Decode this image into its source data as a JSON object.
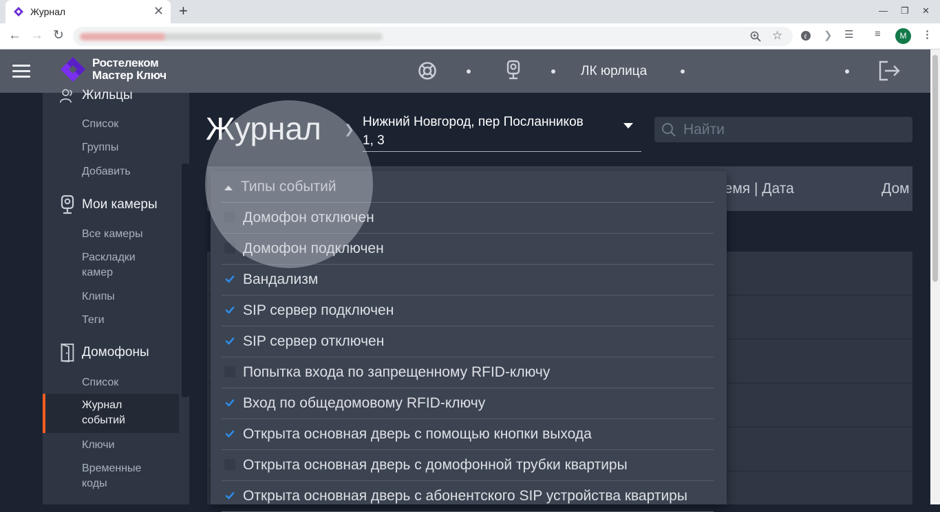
{
  "browser": {
    "tab_title": "Журнал",
    "tab_close": "✕",
    "new_tab": "+",
    "profile_initial": "M"
  },
  "header": {
    "logo_line1": "Ростелеком",
    "logo_line2": "Мастер Ключ",
    "account_link": "ЛК юрлица"
  },
  "sidebar": {
    "residents": {
      "label": "Жильцы",
      "items": [
        "Список",
        "Группы",
        "Добавить"
      ]
    },
    "cameras": {
      "label": "Мои камеры",
      "items": [
        "Все камеры",
        "Раскладки",
        "камер",
        "Клипы",
        "Теги"
      ]
    },
    "intercoms": {
      "label": "Домофоны",
      "items": [
        "Список",
        "Журнал",
        "событий",
        "Ключи",
        "Временные",
        "коды"
      ]
    }
  },
  "main": {
    "title": "Журнал",
    "address_line1": "Нижний Новгород, пер Посланников",
    "address_line2": "1, 3",
    "search_placeholder": "Найти",
    "columns": [
      "ремя | Дата",
      "Дом"
    ]
  },
  "filter": {
    "title": "Типы событий",
    "options": [
      {
        "label": "Домофон отключен",
        "checked": false
      },
      {
        "label": "Домофон подключен",
        "checked": false
      },
      {
        "label": "Вандализм",
        "checked": true
      },
      {
        "label": "SIP сервер подключен",
        "checked": true
      },
      {
        "label": "SIP сервер отключен",
        "checked": true
      },
      {
        "label": "Попытка входа по запрещенному RFID-ключу",
        "checked": false
      },
      {
        "label": "Вход по общедомовому RFID-ключу",
        "checked": true
      },
      {
        "label": "Открыта основная дверь с помощью кнопки выхода",
        "checked": true
      },
      {
        "label": "Открыта основная дверь с домофонной трубки квартиры",
        "checked": false
      },
      {
        "label": "Открыта основная дверь с абонентского SIP устройства квартиры",
        "checked": true
      }
    ]
  },
  "colors": {
    "accent": "#ff5c1f",
    "check": "#2f8be6",
    "brand_purple": "#7b2ff0"
  }
}
